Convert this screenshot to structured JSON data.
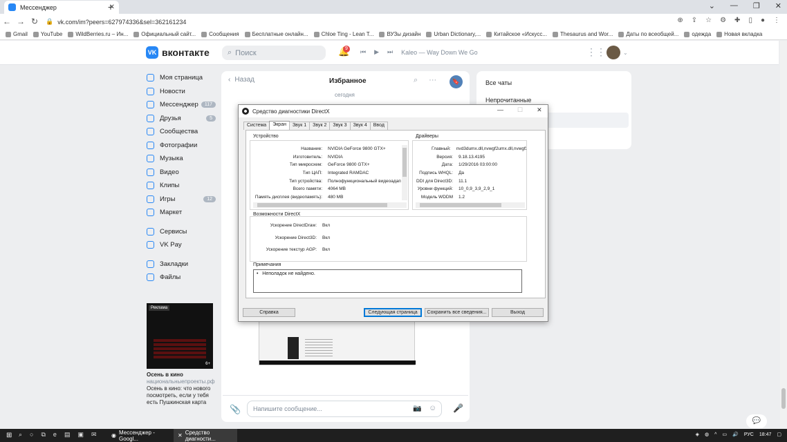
{
  "browser": {
    "tab_title": "Мессенджер",
    "url": "vk.com/im?peers=627974336&sel=362161234",
    "bookmarks": [
      "Gmail",
      "YouTube",
      "WildBerries.ru – Ин...",
      "Официальный сайт...",
      "Сообщения",
      "Бесплатные онлайн...",
      "Chloe Ting - Lean T...",
      "ВУЗы дизайн",
      "Urban Dictionary,...",
      "Китайское «Искусс...",
      "Thesaurus and Wor...",
      "Даты по всеобщей...",
      "одежда",
      "Новая вкладка"
    ]
  },
  "vk": {
    "logo_text": "вконтакте",
    "search_placeholder": "Поиск",
    "notif_count": "9",
    "track": "Kaleo — Way Down We Go",
    "menu": [
      {
        "label": "Моя страница",
        "count": ""
      },
      {
        "label": "Новости",
        "count": ""
      },
      {
        "label": "Мессенджер",
        "count": "117"
      },
      {
        "label": "Друзья",
        "count": "5"
      },
      {
        "label": "Сообщества",
        "count": ""
      },
      {
        "label": "Фотографии",
        "count": ""
      },
      {
        "label": "Музыка",
        "count": ""
      },
      {
        "label": "Видео",
        "count": ""
      },
      {
        "label": "Клипы",
        "count": ""
      },
      {
        "label": "Игры",
        "count": "12"
      },
      {
        "label": "Маркет",
        "count": ""
      }
    ],
    "menu2": [
      "Сервисы",
      "VK Pay"
    ],
    "menu3": [
      "Закладки",
      "Файлы"
    ],
    "ad": {
      "label": "Реклама",
      "age": "6+",
      "title": "Осень в кино",
      "domain": "национальныепроекты.рф",
      "text": "Осень в кино: что нового посмотреть, если у тебя есть Пушкинская карта"
    },
    "chat": {
      "back": "Назад",
      "title": "Избранное",
      "date": "сегодня",
      "input_placeholder": "Напишите сообщение..."
    },
    "right": {
      "all_chats": "Все чаты",
      "unread": "Непрочитанные"
    }
  },
  "dxdiag": {
    "title": "Средство диагностики DirectX",
    "tabs": [
      "Система",
      "Экран",
      "Звук 1",
      "Звук 2",
      "Звук 3",
      "Звук 4",
      "Ввод"
    ],
    "device_header": "Устройство",
    "device_rows": [
      {
        "k": "Название:",
        "v": "NVIDIA GeForce 9800 GTX+"
      },
      {
        "k": "Изготовитель:",
        "v": "NVIDIA"
      },
      {
        "k": "Тип микросхем:",
        "v": "GeForce 9800 GTX+"
      },
      {
        "k": "Тип ЦАП:",
        "v": "Integrated RAMDAC"
      },
      {
        "k": "Тип устройства:",
        "v": "Полнофункциональный видеоадап"
      },
      {
        "k": "Всего памяти:",
        "v": "4064 MB"
      },
      {
        "k": "Память дисплея (видеопамять):",
        "v": "480 MB"
      }
    ],
    "drivers_header": "Драйверы",
    "driver_rows": [
      {
        "k": "Главный:",
        "v": "nvd3dumx.dll,nvwgf2umx.dll,nvwgf2u"
      },
      {
        "k": "Версия:",
        "v": "9.18.13.4195"
      },
      {
        "k": "Дата:",
        "v": "1/29/2016 03:00:00"
      },
      {
        "k": "Подпись WHQL:",
        "v": "Да"
      },
      {
        "k": "DDI для Direct3D:",
        "v": "11.1"
      },
      {
        "k": "Уровни функций:",
        "v": "10_0,9_3,9_2,9_1"
      },
      {
        "k": "Модель WDDM",
        "v": "1.2"
      }
    ],
    "dx_header": "Возможности DirectX",
    "dx_rows": [
      {
        "k": "Ускорение DirectDraw:",
        "v": "Вкл"
      },
      {
        "k": "Ускорение Direct3D:",
        "v": "Вкл"
      },
      {
        "k": "Ускорение текстур AGP:",
        "v": "Вкл"
      }
    ],
    "notes_header": "Примечания",
    "notes_text": "Неполадок не найдено.",
    "buttons": {
      "help": "Справка",
      "next": "Следующая страница",
      "save": "Сохранить все сведения...",
      "exit": "Выход"
    }
  },
  "taskbar": {
    "task1": "Мессенджер - Googl...",
    "task2": "Средство диагности...",
    "lang": "РУС",
    "time": "18:47"
  },
  "colors": {
    "vk_blue": "#2787f5",
    "badge_red": "#e64646",
    "taskbar": "#1f1f1f"
  }
}
